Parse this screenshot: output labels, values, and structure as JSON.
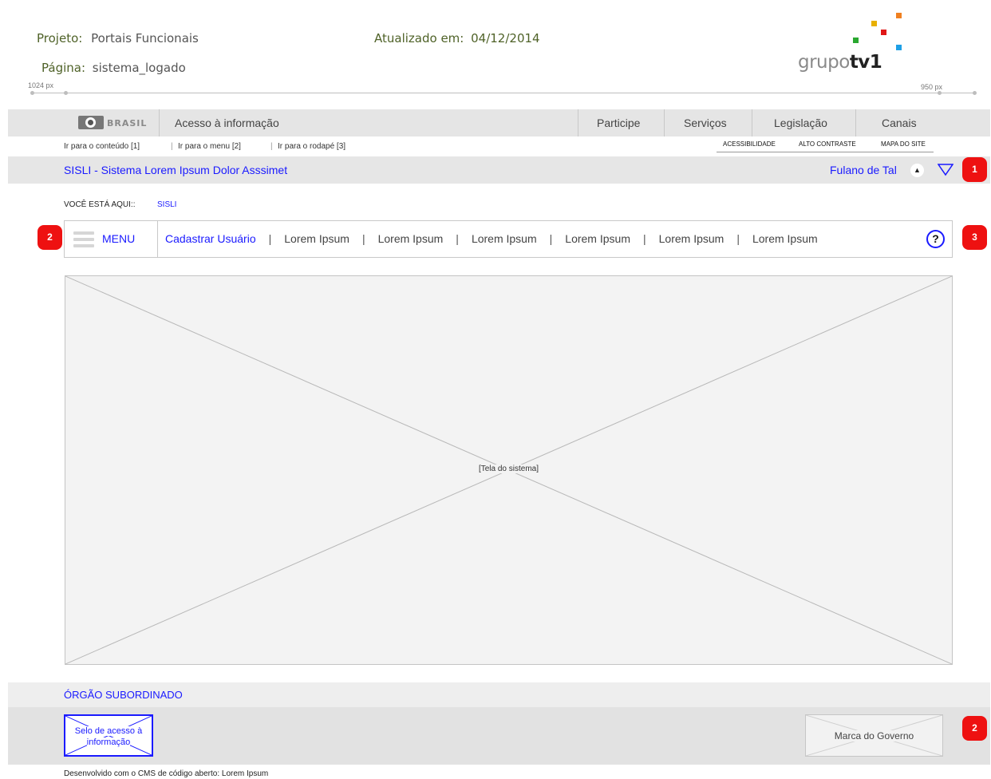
{
  "meta": {
    "project_label": "Projeto:",
    "project_value": "Portais Funcionais",
    "page_label": "Página:",
    "page_value": "sistema_logado",
    "updated_label": "Atualizado em:",
    "updated_value": "04/12/2014"
  },
  "ruler": {
    "left": "1024 px",
    "right": "950 px"
  },
  "logo": {
    "text_light": "grupo",
    "text_bold": "tv1",
    "colors": [
      "#f08020",
      "#e8b000",
      "#e01818",
      "#2aa830",
      "#1ea0e6"
    ]
  },
  "govbar": {
    "brasil": "BRASIL",
    "acesso": "Acesso à informação",
    "links": [
      "Participe",
      "Serviços",
      "Legislação",
      "Canais"
    ]
  },
  "accessibility": {
    "skip_links": [
      "Ir para o conteúdo [1]",
      "Ir para o menu [2]",
      "Ir para o rodapé [3]"
    ],
    "right_links": [
      "ACESSIBILIDADE",
      "ALTO CONTRASTE",
      "MAPA DO SITE"
    ]
  },
  "system": {
    "title": "SISLI - Sistema Lorem Ipsum Dolor Asssimet",
    "user": "Fulano de Tal"
  },
  "badges": {
    "b1": "1",
    "b2": "2",
    "b3": "3",
    "b4": "2"
  },
  "breadcrumb": {
    "label": "VOCÊ ESTÁ AQUI::",
    "current": "SISLI"
  },
  "menu": {
    "label": "MENU",
    "items": [
      "Cadastrar Usuário",
      "Lorem Ipsum",
      "Lorem Ipsum",
      "Lorem Ipsum",
      "Lorem Ipsum",
      "Lorem Ipsum",
      "Lorem Ipsum"
    ],
    "help": "?"
  },
  "content": {
    "placeholder": "[Tela do sistema]"
  },
  "footer": {
    "orgao": "ÓRGÃO SUBORDINADO",
    "selo_line1": "Selo de acesso à",
    "selo_line2": "informação",
    "marca": "Marca do Governo",
    "developed": "Desenvolvido com o CMS de código aberto: Lorem Ipsum"
  },
  "colors": {
    "link_blue": "#1a1aff",
    "badge_red": "#ee1111",
    "meta_green": "#4f6228"
  }
}
